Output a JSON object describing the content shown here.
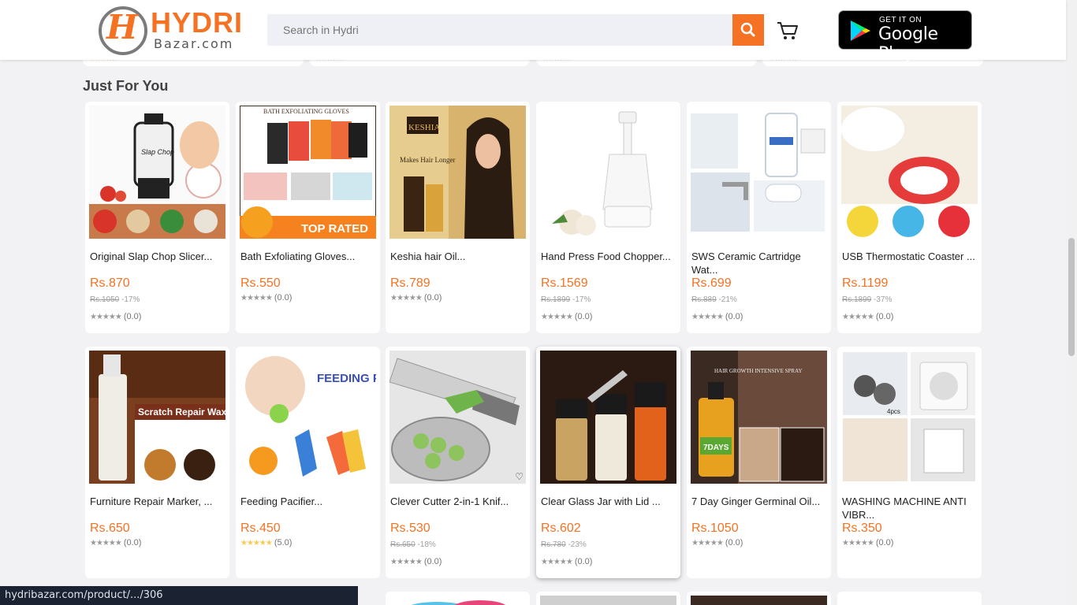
{
  "header": {
    "logo": {
      "mark": "H",
      "name": "HYDRI",
      "sub": "Bazar.com"
    },
    "search": {
      "placeholder": "Search in Hydri"
    },
    "icons": {
      "search": "search-icon",
      "cart": "cart-icon",
      "google_play": "google-play-icon"
    },
    "google_play": {
      "small": "GET IT ON",
      "big": "Google Play"
    }
  },
  "section": {
    "title": "Just For You"
  },
  "products": [
    {
      "name": "Original Slap Chop Slicer...",
      "price": "Rs.870",
      "old_price": "Rs.1050",
      "discount": "-17%",
      "rating": "(0.0)"
    },
    {
      "name": "Bath Exfoliating Gloves...",
      "price": "Rs.550",
      "old_price": "",
      "discount": "",
      "rating": "(0.0)"
    },
    {
      "name": "Keshia hair Oil...",
      "price": "Rs.789",
      "old_price": "",
      "discount": "",
      "rating": "(0.0)"
    },
    {
      "name": "Hand Press Food Chopper...",
      "price": "Rs.1569",
      "old_price": "Rs.1899",
      "discount": "-17%",
      "rating": "(0.0)"
    },
    {
      "name": "SWS Ceramic Cartridge Wat...",
      "price": "Rs.699",
      "old_price": "Rs.889",
      "discount": "-21%",
      "rating": "(0.0)"
    },
    {
      "name": "USB Thermostatic Coaster ...",
      "price": "Rs.1199",
      "old_price": "Rs.1899",
      "discount": "-37%",
      "rating": "(0.0)"
    },
    {
      "name": "Furniture Repair Marker, ...",
      "price": "Rs.650",
      "old_price": "",
      "discount": "",
      "rating": "(0.0)"
    },
    {
      "name": "Feeding Pacifier...",
      "price": "Rs.450",
      "old_price": "",
      "discount": "",
      "rating": "(5.0)"
    },
    {
      "name": "Clever Cutter 2-in-1 Knif...",
      "price": "Rs.530",
      "old_price": "Rs.650",
      "discount": "-18%",
      "rating": "(0.0)"
    },
    {
      "name": "Clear Glass Jar with Lid ...",
      "price": "Rs.602",
      "old_price": "Rs.780",
      "discount": "-23%",
      "rating": "(0.0)"
    },
    {
      "name": "7 Day Ginger Germinal Oil...",
      "price": "Rs.1050",
      "old_price": "",
      "discount": "",
      "rating": "(0.0)"
    },
    {
      "name": "WASHING MACHINE ANTI VIBR...",
      "price": "Rs.350",
      "old_price": "",
      "discount": "",
      "rating": "(0.0)"
    }
  ],
  "image_text": {
    "p1": "Slap Chop",
    "p2_top": "BATH EXFOLIATING GLOVES",
    "p2_badge": "TOP RATED",
    "p3_brand": "KESHIA",
    "p3_caption": "Makes Hair Longer",
    "p7_banner": "Scratch Repair Wax",
    "p8_title": "FEEDING PACIFIER",
    "p11_caption": "HAIR GROWTH INTENSIVE SPRAY",
    "p11_badge": "7DAYS",
    "p12_badge": "4pcs"
  },
  "status_bar": {
    "url": "hydribazar.com/product/.../306"
  }
}
